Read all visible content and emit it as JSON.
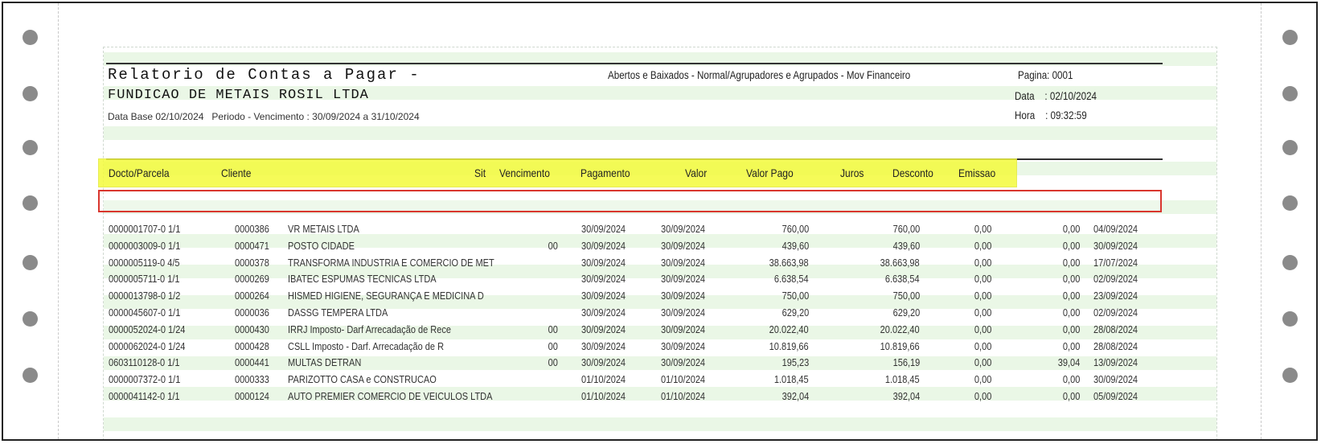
{
  "report": {
    "title": "Relatorio de Contas a Pagar -",
    "filter": "Abertos e Baixados - Normal/Agrupadores e Agrupados - Mov Financeiro",
    "page_label": "Pagina: 0001",
    "company": "FUNDICAO DE METAIS ROSIL LTDA",
    "date_line": "Data    : 02/10/2024",
    "base_period": "Data Base 02/10/2024   Periodo - Vencimento : 30/09/2024 a 31/10/2024",
    "time_line": "Hora    : 09:32:59"
  },
  "columns": {
    "doc": "Docto/Parcela",
    "client": "Cliente",
    "sit": "Sit",
    "due": "Vencimento",
    "payment": "Pagamento",
    "value": "Valor",
    "paid": "Valor Pago",
    "interest": "Juros",
    "discount": "Desconto",
    "issue": "Emissao"
  },
  "rows": [
    {
      "doc": "0000001707-0 1/1",
      "code": "0000386",
      "name": "VR METAIS LTDA",
      "sit": "",
      "due": "30/09/2024",
      "pay": "30/09/2024",
      "value": "760,00",
      "paid": "760,00",
      "interest": "0,00",
      "discount": "0,00",
      "issue": "04/09/2024"
    },
    {
      "doc": "0000003009-0 1/1",
      "code": "0000471",
      "name": "POSTO CIDADE",
      "sit": "00",
      "due": "30/09/2024",
      "pay": "30/09/2024",
      "value": "439,60",
      "paid": "439,60",
      "interest": "0,00",
      "discount": "0,00",
      "issue": "30/09/2024"
    },
    {
      "doc": "0000005119-0 4/5",
      "code": "0000378",
      "name": "TRANSFORMA INDUSTRIA E COMERCIO DE MET",
      "sit": "",
      "due": "30/09/2024",
      "pay": "30/09/2024",
      "value": "38.663,98",
      "paid": "38.663,98",
      "interest": "0,00",
      "discount": "0,00",
      "issue": "17/07/2024"
    },
    {
      "doc": "0000005711-0 1/1",
      "code": "0000269",
      "name": "IBATEC ESPUMAS TECNICAS LTDA",
      "sit": "",
      "due": "30/09/2024",
      "pay": "30/09/2024",
      "value": "6.638,54",
      "paid": "6.638,54",
      "interest": "0,00",
      "discount": "0,00",
      "issue": "02/09/2024"
    },
    {
      "doc": "0000013798-0 1/2",
      "code": "0000264",
      "name": "HISMED HIGIENE, SEGURANÇA E MEDICINA D",
      "sit": "",
      "due": "30/09/2024",
      "pay": "30/09/2024",
      "value": "750,00",
      "paid": "750,00",
      "interest": "0,00",
      "discount": "0,00",
      "issue": "23/09/2024"
    },
    {
      "doc": "0000045607-0 1/1",
      "code": "0000036",
      "name": "DASSG TEMPERA LTDA",
      "sit": "",
      "due": "30/09/2024",
      "pay": "30/09/2024",
      "value": "629,20",
      "paid": "629,20",
      "interest": "0,00",
      "discount": "0,00",
      "issue": "02/09/2024"
    },
    {
      "doc": "0000052024-0 1/24",
      "code": "0000430",
      "name": "IRRJ Imposto- Darf Arrecadação de Rece",
      "sit": "00",
      "due": "30/09/2024",
      "pay": "30/09/2024",
      "value": "20.022,40",
      "paid": "20.022,40",
      "interest": "0,00",
      "discount": "0,00",
      "issue": "28/08/2024"
    },
    {
      "doc": "0000062024-0 1/24",
      "code": "0000428",
      "name": "CSLL Imposto  - Darf. Arrecadação de R",
      "sit": "00",
      "due": "30/09/2024",
      "pay": "30/09/2024",
      "value": "10.819,66",
      "paid": "10.819,66",
      "interest": "0,00",
      "discount": "0,00",
      "issue": "28/08/2024"
    },
    {
      "doc": "0603110128-0 1/1",
      "code": "0000441",
      "name": "MULTAS DETRAN",
      "sit": "00",
      "due": "30/09/2024",
      "pay": "30/09/2024",
      "value": "195,23",
      "paid": "156,19",
      "interest": "0,00",
      "discount": "39,04",
      "issue": "13/09/2024"
    },
    {
      "doc": "0000007372-0 1/1",
      "code": "0000333",
      "name": "PARIZOTTO CASA e CONSTRUCAO",
      "sit": "",
      "due": "01/10/2024",
      "pay": "01/10/2024",
      "value": "1.018,45",
      "paid": "1.018,45",
      "interest": "0,00",
      "discount": "0,00",
      "issue": "30/09/2024"
    },
    {
      "doc": "0000041142-0 1/1",
      "code": "0000124",
      "name": "AUTO PREMIER COMERCIO DE VEICULOS LTDA",
      "sit": "",
      "due": "01/10/2024",
      "pay": "01/10/2024",
      "value": "392,04",
      "paid": "392,04",
      "interest": "0,00",
      "discount": "0,00",
      "issue": "05/09/2024"
    }
  ]
}
